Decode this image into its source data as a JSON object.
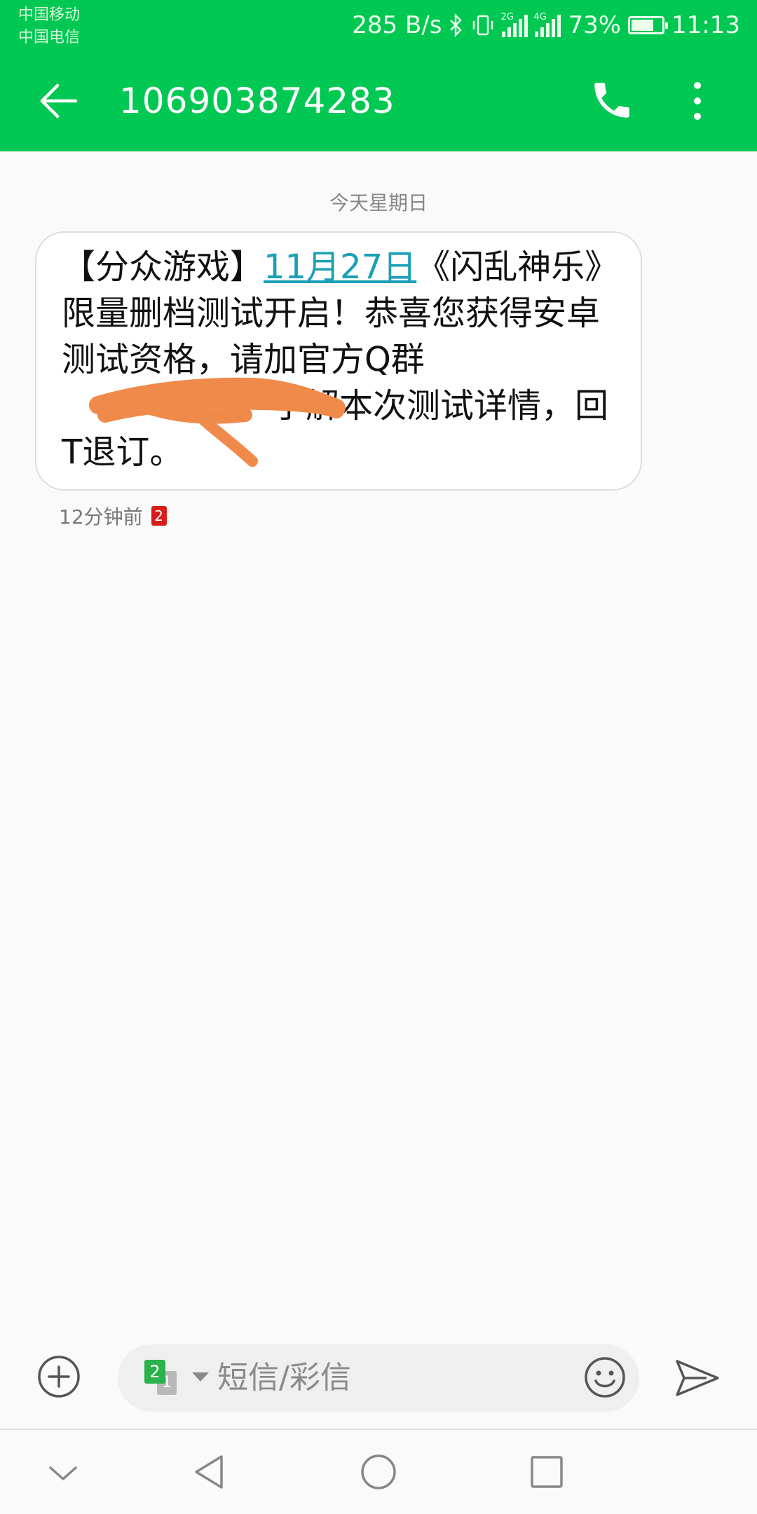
{
  "status_bar": {
    "carrier_1": "中国移动",
    "carrier_2": "中国电信",
    "net_speed": "285 B/s",
    "sim1_network": "2G",
    "sim2_network": "4G",
    "battery_percent": "73%",
    "battery_level": 0.73,
    "time": "11:13",
    "icons": [
      "bluetooth-icon",
      "vibrate-icon",
      "signal-icon",
      "battery-icon"
    ]
  },
  "header": {
    "title": "106903874283",
    "icons": [
      "back-arrow-icon",
      "phone-icon",
      "more-vert-icon"
    ]
  },
  "conversation": {
    "date_separator": "今天星期日",
    "message": {
      "text_before_link": "【分众游戏】",
      "link_text": "11月27日",
      "text_after_link": "《闪乱神乐》限量删档测试开启！恭喜您获得安卓测试资格，请加官方Q群",
      "text_end": "了解本次测试详情，回T退订。",
      "time_ago": "12分钟前",
      "sim_badge": "2"
    }
  },
  "composer": {
    "placeholder": "短信/彩信",
    "sim_front": "2",
    "sim_back": "1",
    "icons": [
      "add-circle-icon",
      "sim-switch-icon",
      "dropdown-caret-icon",
      "emoji-icon",
      "send-icon"
    ]
  },
  "navbar": {
    "icons": [
      "collapse-chevron-icon",
      "nav-back-icon",
      "nav-home-icon",
      "nav-recents-icon"
    ]
  },
  "colors": {
    "accent_green": "#00c853",
    "link": "#1aa0b7",
    "redaction": "#f08a4b"
  }
}
